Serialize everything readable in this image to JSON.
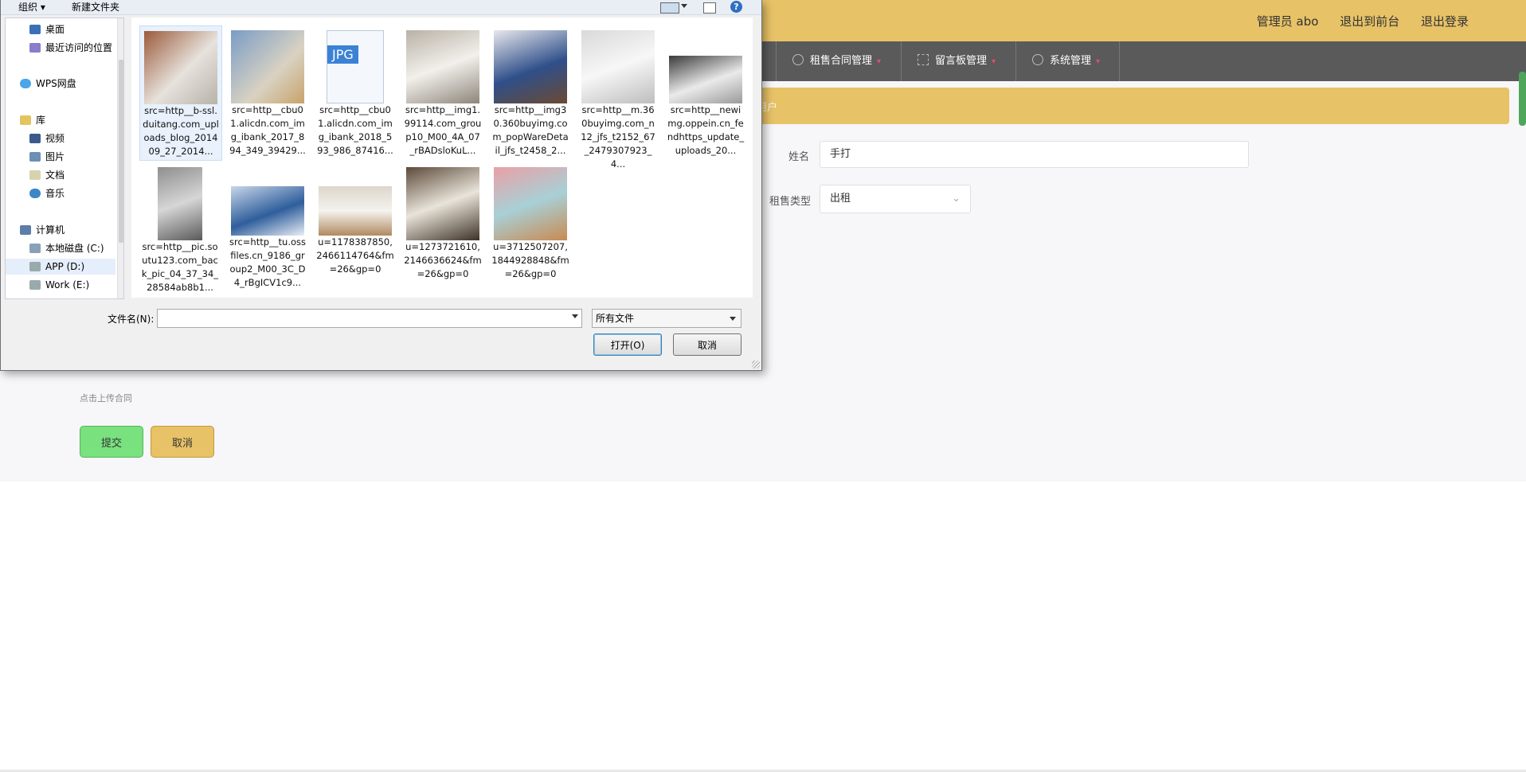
{
  "app": {
    "user_links": [
      "管理员 abo",
      "退出到前台",
      "退出登录"
    ],
    "nav": [
      {
        "label": "租售合同管理"
      },
      {
        "label": "留言板管理"
      },
      {
        "label": "系统管理"
      }
    ],
    "breadcrumb": "用户",
    "form": {
      "name_label": "姓名",
      "name_value": "手打",
      "type_label": "租售类型",
      "type_value": "出租",
      "upload_hint": "点击上传合同",
      "submit_label": "提交",
      "cancel_label": "取消"
    }
  },
  "dialog": {
    "toolbar": {
      "organize": "组织 ▾",
      "new_folder": "新建文件夹"
    },
    "nav_items": [
      "桌面",
      "最近访问的位置",
      "WPS网盘",
      "库",
      "视频",
      "图片",
      "文档",
      "音乐",
      "计算机",
      "本地磁盘 (C:)",
      "APP (D:)",
      "Work (E:)"
    ],
    "files": [
      "src=http__b-ssl.duitang.com_uploads_blog_201409_27_2014...",
      "src=http__cbu01.alicdn.com_img_ibank_2017_894_349_39429...",
      "src=http__cbu01.alicdn.com_img_ibank_2018_593_986_87416...",
      "src=http__img1.99114.com_group10_M00_4A_07_rBADsloKuL...",
      "src=http__img30.360buyimg.com_popWareDetail_jfs_t2458_2...",
      "src=http__m.360buyimg.com_n12_jfs_t2152_67_2479307923_4...",
      "src=http__newimg.oppein.cn_fendhttps_update_uploads_20...",
      "src=http__pic.soutu123.com_back_pic_04_37_34_28584ab8b1...",
      "src=http__tu.ossfiles.cn_9186_group2_M00_3C_D4_rBgICV1c9...",
      "u=1178387850,2466114764&fm=26&gp=0",
      "u=1273721610,2146636624&fm=26&gp=0",
      "u=3712507207,1844928848&fm=26&gp=0"
    ],
    "jpg_badge": "JPG",
    "filename_label": "文件名(N):",
    "filename_value": "",
    "filter_value": "所有文件",
    "open_label": "打开(O)",
    "cancel_label": "取消"
  }
}
